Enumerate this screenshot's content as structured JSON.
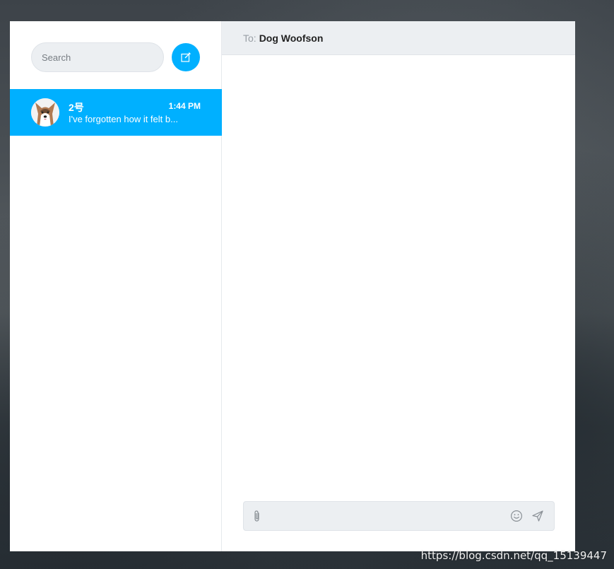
{
  "sidebar": {
    "search_placeholder": "Search",
    "conversations": [
      {
        "name": "2号",
        "time": "1:44 PM",
        "preview": "I've forgotten how it felt b..."
      }
    ]
  },
  "chat": {
    "to_label": "To:",
    "recipient": "Dog Woofson",
    "message_value": ""
  },
  "watermark": "https://blog.csdn.net/qq_15139447",
  "colors": {
    "accent": "#00b0ff",
    "panel_bg": "#eceff2",
    "window_bg": "#ffffff"
  },
  "icons": {
    "compose": "compose-icon",
    "attach": "paperclip-icon",
    "emoji": "smiley-icon",
    "send": "send-icon"
  }
}
